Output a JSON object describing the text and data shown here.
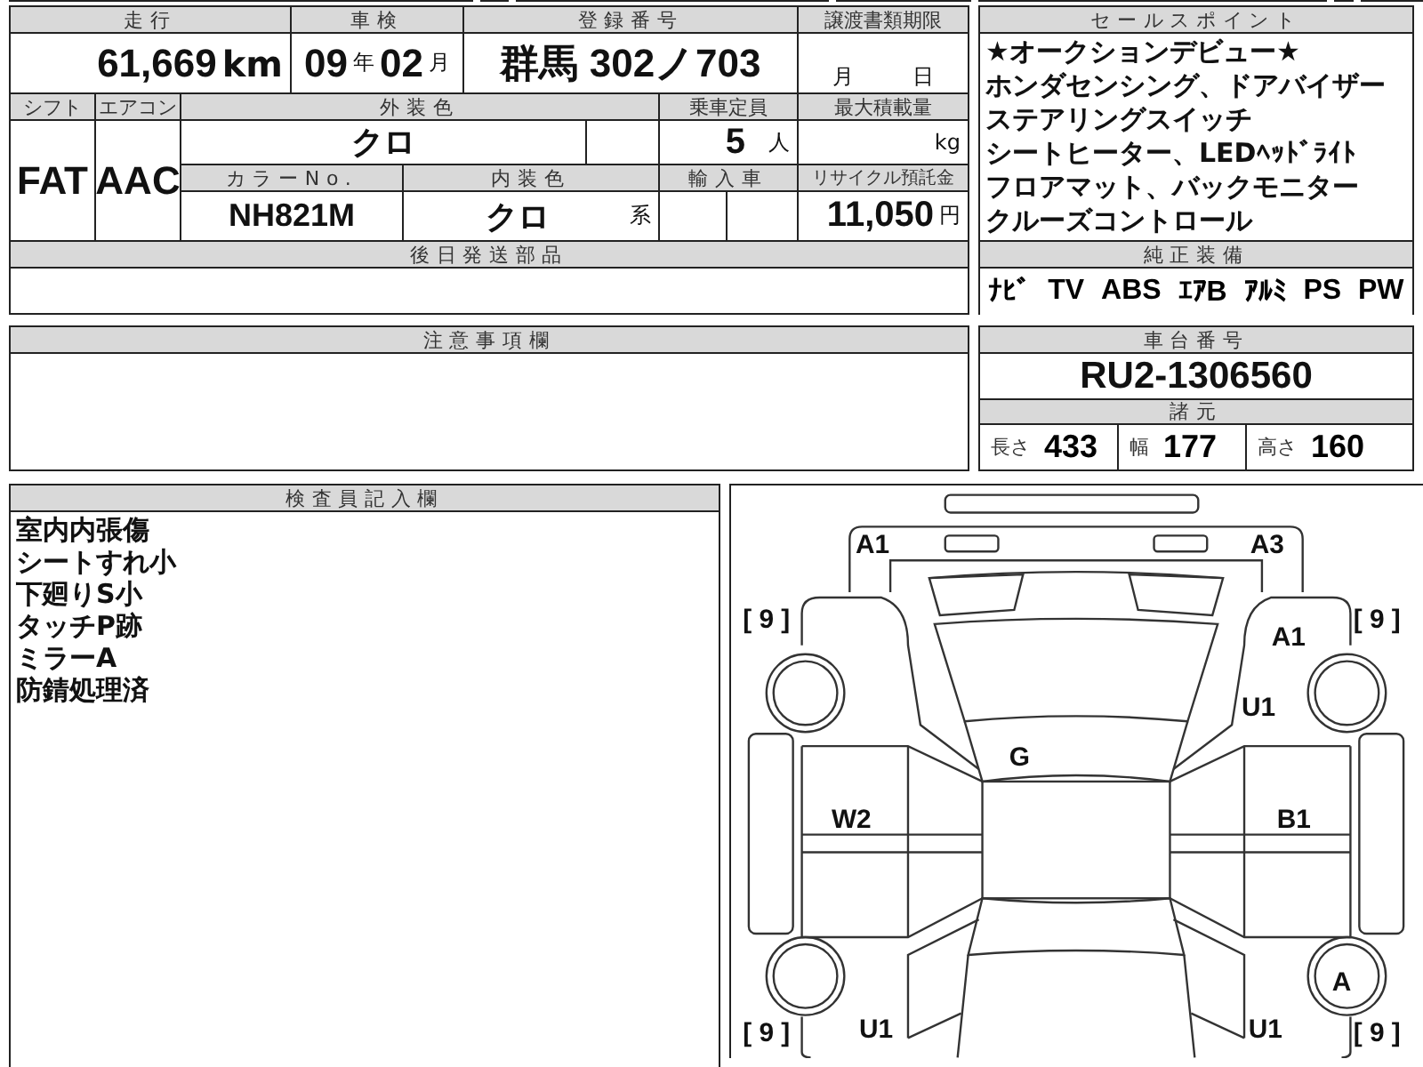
{
  "mileage": {
    "label": "走行",
    "value": "61,669",
    "unit": "km"
  },
  "inspection": {
    "label": "車検",
    "year": "09",
    "year_unit": "年",
    "month": "02",
    "month_unit": "月"
  },
  "registration": {
    "label": "登録番号",
    "value": "群馬 302ノ703"
  },
  "transfer_deadline": {
    "label": "譲渡書類期限",
    "month_unit": "月",
    "day_unit": "日"
  },
  "shift": {
    "label": "シフト",
    "value": "FAT"
  },
  "aircon": {
    "label": "エアコン",
    "value": "AAC"
  },
  "exterior_color": {
    "label": "外装色",
    "value": "クロ"
  },
  "capacity": {
    "label": "乗車定員",
    "value": "5",
    "unit": "人"
  },
  "max_load": {
    "label": "最大積載量",
    "unit": "kg"
  },
  "color_no": {
    "label": "カラーNo.",
    "value": "NH821M"
  },
  "interior_color": {
    "label": "内装色",
    "value": "クロ",
    "suffix": "系"
  },
  "imported": {
    "label": "輸入車"
  },
  "recycle_fee": {
    "label": "リサイクル預託金",
    "value": "11,050",
    "unit": "円"
  },
  "later_parts": {
    "label": "後日発送部品"
  },
  "sale_points": {
    "label": "セールスポイント",
    "lines": [
      "★オークションデビュー★",
      "ホンダセンシング、ドアバイザー",
      "ステアリングスイッチ",
      "シートヒーター、LEDﾍｯﾄﾞﾗｲﾄ",
      "フロアマット、バックモニター",
      "クルーズコントロール"
    ]
  },
  "genuine_equipment": {
    "label": "純正装備",
    "items": [
      "ﾅﾋﾞ",
      "TV",
      "ABS",
      "ｴｱB",
      "ｱﾙﾐ",
      "PS",
      "PW"
    ]
  },
  "notes": {
    "label": "注意事項欄"
  },
  "chassis": {
    "label": "車台番号",
    "value": "RU2-1306560"
  },
  "specs": {
    "label": "諸元",
    "items": [
      {
        "label": "長さ",
        "value": "433"
      },
      {
        "label": "幅",
        "value": "177"
      },
      {
        "label": "高さ",
        "value": "160"
      }
    ]
  },
  "inspector": {
    "label": "検査員記入欄",
    "lines": [
      "室内内張傷",
      "シートすれ小",
      "下廻りS小",
      "タッチP跡",
      "ミラーA",
      "防錆処理済"
    ]
  },
  "diagram": {
    "labels": [
      "A1",
      "A3",
      "[ 9 ]",
      "[ 9 ]",
      "A1",
      "U1",
      "G",
      "W2",
      "B1",
      "A",
      "[ 9 ]",
      "U1",
      "U1",
      "[ 9 ]"
    ]
  }
}
